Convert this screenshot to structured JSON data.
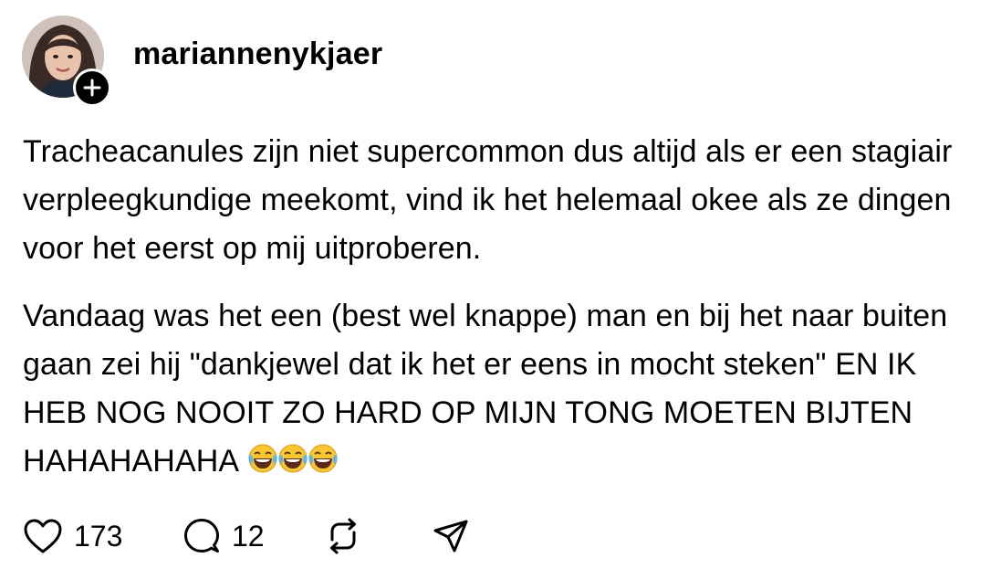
{
  "post": {
    "username": "mariannenykjaer",
    "paragraphs": [
      "Tracheacanules zijn niet supercommon dus altijd als er een stagiair verpleegkundige meekomt, vind ik het helemaal okee als ze dingen voor het eerst op mij uitproberen.",
      "Vandaag was het een (best wel knappe) man en bij het naar buiten gaan zei hij \"dankjewel dat ik het er eens in mocht steken\" EN IK HEB NOG NOOIT ZO HARD OP MIJN TONG MOETEN BIJTEN HAHAHAHAHA"
    ],
    "emojis": [
      "laughing-tears",
      "laughing-tears",
      "laughing-tears"
    ]
  },
  "actions": {
    "like_count": "173",
    "reply_count": "12"
  },
  "icons": {
    "like": "heart-icon",
    "reply": "comment-icon",
    "repost": "repost-icon",
    "share": "send-icon",
    "follow": "plus-icon"
  },
  "colors": {
    "text": "#000000",
    "background": "#ffffff",
    "emoji_face": "#f7c631"
  }
}
